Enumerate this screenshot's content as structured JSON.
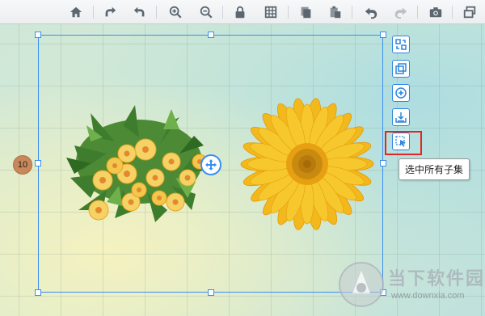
{
  "toolbar": {
    "buttons": [
      {
        "name": "home",
        "icon": "home-icon"
      },
      {
        "name": "rotate-right",
        "icon": "rotate-right-icon"
      },
      {
        "name": "rotate-left",
        "icon": "rotate-left-icon"
      },
      {
        "name": "zoom-in",
        "icon": "zoom-in-icon"
      },
      {
        "name": "zoom-out",
        "icon": "zoom-out-icon"
      },
      {
        "name": "lock",
        "icon": "lock-icon"
      },
      {
        "name": "grid",
        "icon": "grid-icon"
      },
      {
        "name": "copy",
        "icon": "copy-icon"
      },
      {
        "name": "paste",
        "icon": "paste-icon"
      },
      {
        "name": "undo",
        "icon": "undo-icon"
      },
      {
        "name": "redo",
        "icon": "redo-icon"
      },
      {
        "name": "screenshot",
        "icon": "camera-icon"
      },
      {
        "name": "window",
        "icon": "window-icon"
      }
    ]
  },
  "canvas": {
    "layer_badge": "10",
    "objects": [
      "flower-bouquet",
      "sunflower"
    ]
  },
  "side_panel": {
    "buttons": [
      "arrange-icon",
      "group-icon",
      "add-icon",
      "save-icon",
      "select-children-icon"
    ],
    "active_button": "select-children-icon",
    "tooltip": "选中所有子集"
  },
  "watermark": {
    "title": "当下软件园",
    "url": "www.downxia.com"
  },
  "colors": {
    "selection": "#3b8ef0",
    "highlight": "#e02626",
    "badge": "#c9875a"
  }
}
